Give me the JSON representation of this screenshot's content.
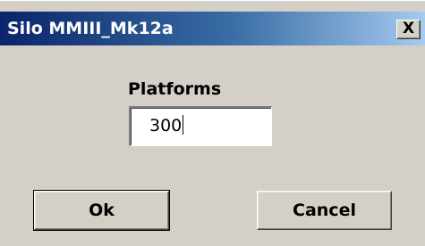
{
  "window": {
    "title": "Silo MMIII_Mk12a",
    "close_label": "X"
  },
  "form": {
    "field_label": "Platforms",
    "field_value": "300"
  },
  "buttons": {
    "ok_label": "Ok",
    "cancel_label": "Cancel"
  },
  "colors": {
    "titlebar_start": "#0a246a",
    "titlebar_end": "#a6caf0",
    "face": "#d4d0c8"
  }
}
